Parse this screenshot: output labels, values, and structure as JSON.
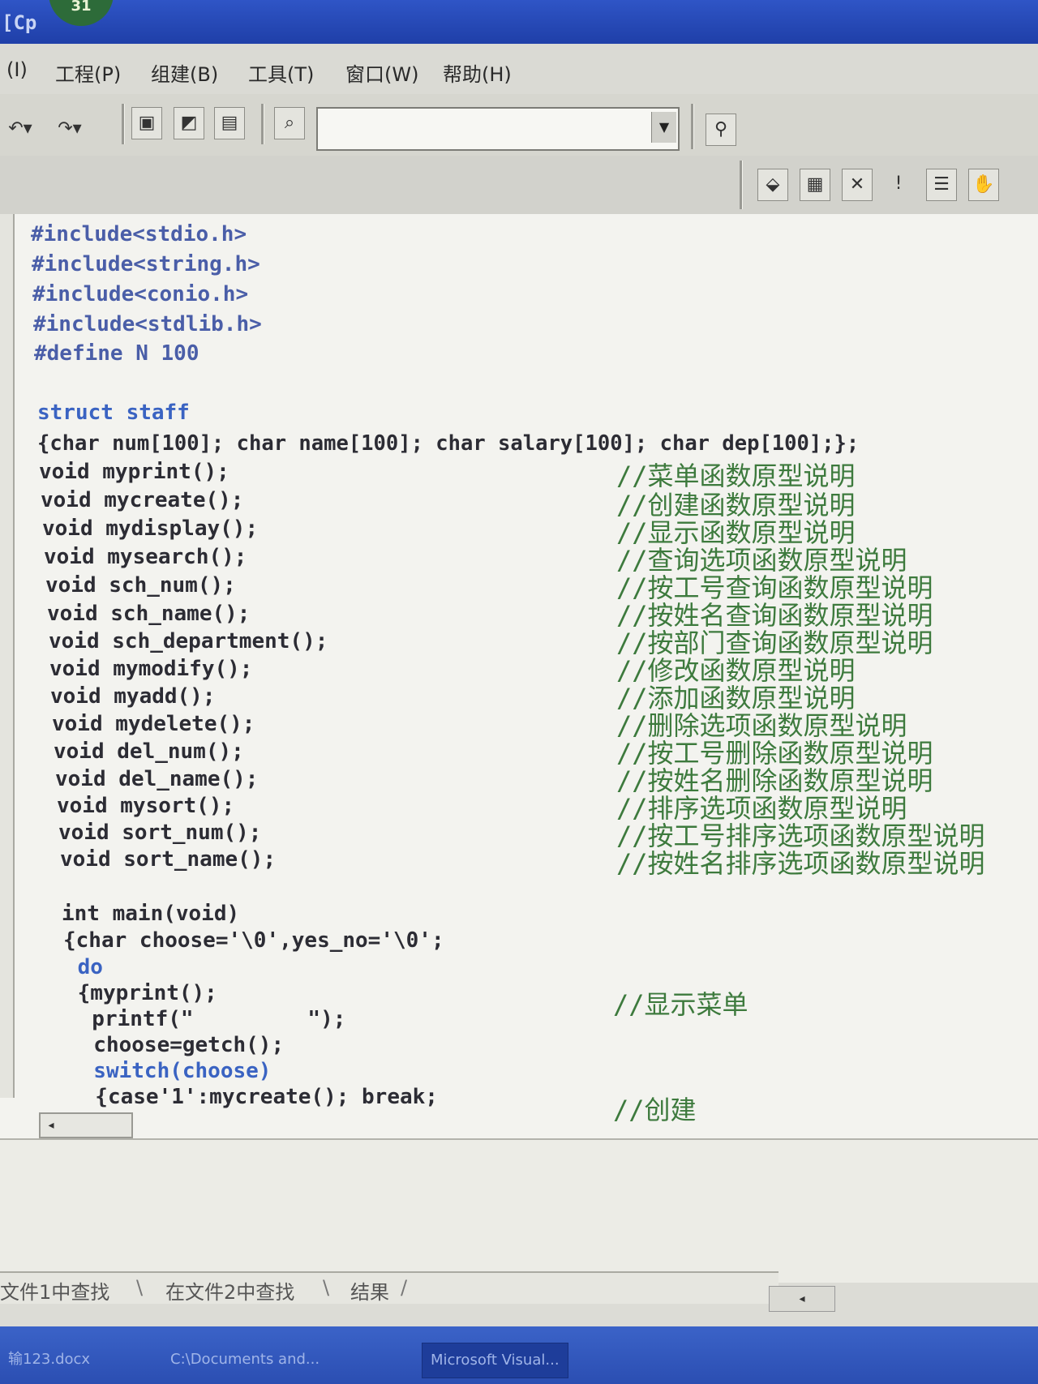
{
  "window": {
    "title": "[Cp",
    "badge": "31"
  },
  "menu": [
    {
      "label": "(I)"
    },
    {
      "label": "工程(P)"
    },
    {
      "label": "组建(B)"
    },
    {
      "label": "工具(T)"
    },
    {
      "label": "窗口(W)"
    },
    {
      "label": "帮助(H)"
    }
  ],
  "toolbar": {
    "undo_icon": "↶▾",
    "redo_icon": "↷▾",
    "combo_arrow": "▼",
    "search_value": ""
  },
  "code": {
    "lines": [
      "#include<stdio.h>",
      "#include<string.h>",
      "#include<conio.h>",
      "#include<stdlib.h>",
      "#define N 100",
      "",
      "struct staff",
      "{char num[100]; char name[100]; char salary[100]; char dep[100];};",
      "void myprint();",
      "void mycreate();",
      "void mydisplay();",
      "void mysearch();",
      "void sch_num();",
      "void sch_name();",
      "void sch_department();",
      "void mymodify();",
      "void myadd();",
      "void mydelete();",
      "void del_num();",
      "void del_name();",
      "void mysort();",
      "void sort_num();",
      "void sort_name();",
      "",
      "int main(void)",
      "{char choose='\\0',yes_no='\\0';",
      " do",
      " {myprint();",
      "  printf(\"         \");",
      "  choose=getch();",
      "  switch(choose)",
      "  {case'1':mycreate(); break;"
    ],
    "comments": [
      "//菜单函数原型说明",
      "//创建函数原型说明",
      "//显示函数原型说明",
      "//查询选项函数原型说明",
      "//按工号查询函数原型说明",
      "//按姓名查询函数原型说明",
      "//按部门查询函数原型说明",
      "//修改函数原型说明",
      "//添加函数原型说明",
      "//删除选项函数原型说明",
      "//按工号删除函数原型说明",
      "//按姓名删除函数原型说明",
      "//排序选项函数原型说明",
      "//按工号排序选项函数原型说明",
      "//按姓名排序选项函数原型说明",
      "//显示菜单",
      "//创建"
    ]
  },
  "editor": {
    "hscroll_arrow": "◂"
  },
  "output": {
    "tabs": [
      {
        "label": "文件1中查找"
      },
      {
        "label": "在文件2中查找"
      },
      {
        "label": "结果"
      }
    ],
    "scroll_arrow": "◂"
  },
  "taskbar": [
    {
      "label": "输123.docx"
    },
    {
      "label": "C:\\Documents and..."
    },
    {
      "label": "Microsoft Visual..."
    }
  ]
}
